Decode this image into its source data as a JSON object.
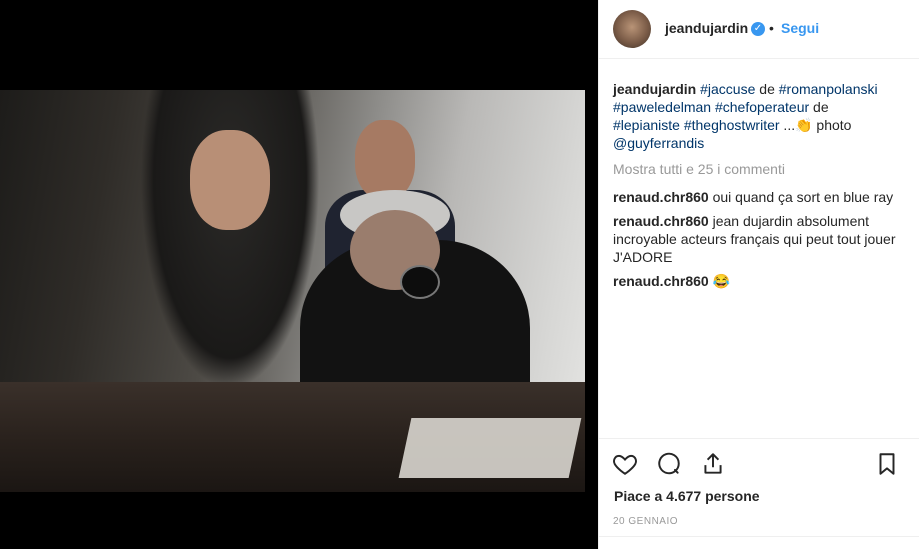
{
  "post": {
    "username": "jeandujardin",
    "verified_icon": "verified-badge-icon",
    "separator": "•",
    "follow_label": "Segui",
    "caption": {
      "username": "jeandujardin",
      "parts": [
        "#jaccuse",
        " de ",
        "#romanpolanski",
        " ",
        "#paweledelman",
        " ",
        "#chefoperateur",
        " de ",
        "#lepianiste",
        " ",
        "#theghostwriter",
        " ...",
        "👏",
        " photo ",
        "@guyferrandis"
      ]
    },
    "view_all_comments": "Mostra tutti e 25 i commenti",
    "comments": [
      {
        "username": "renaud.chr860",
        "text": "oui quand ça sort en blue ray"
      },
      {
        "username": "renaud.chr860",
        "text": "jean dujardin absolument incroyable acteurs français qui peut tout jouer J'ADORE"
      },
      {
        "username": "renaud.chr860",
        "text": "😂"
      }
    ],
    "likes_text": "Piace a 4.677 persone",
    "date": "20 GENNAIO",
    "colors": {
      "link": "#003569",
      "accent": "#3897f0",
      "text": "#262626",
      "muted": "#999999"
    }
  }
}
